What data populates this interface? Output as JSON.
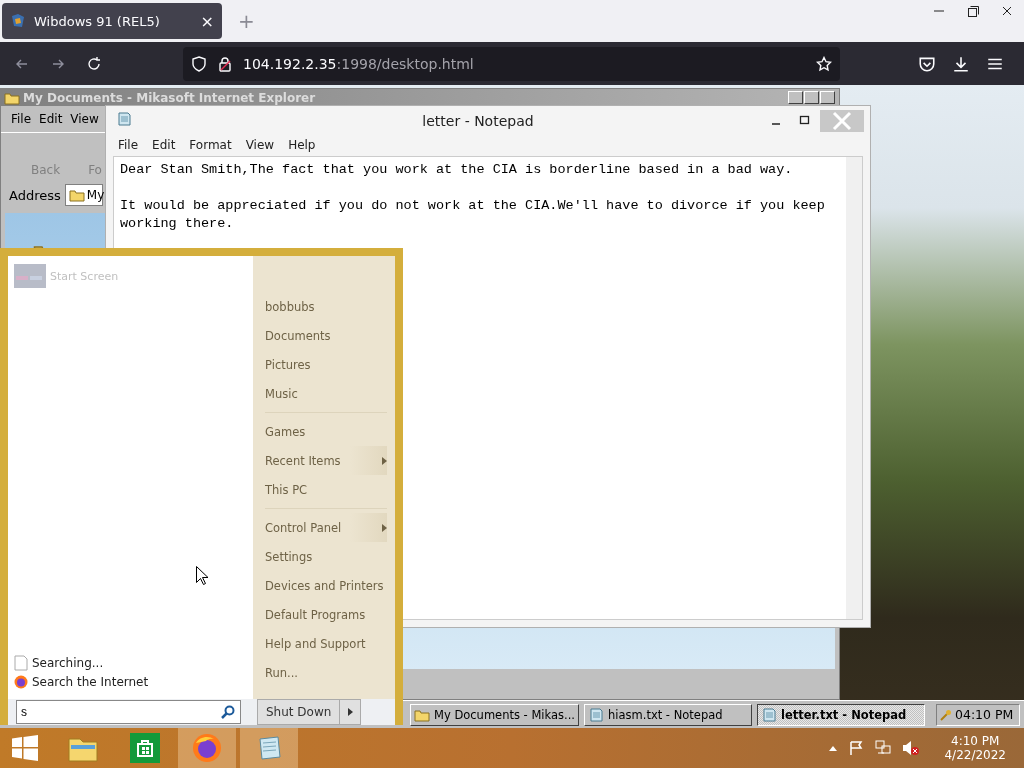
{
  "browser": {
    "tab": {
      "title": "Wibdows 91 (REL5)",
      "close": "×"
    },
    "new_tab": "+",
    "address": {
      "host": "104.192.2.35",
      "rest": ":1998/desktop.html"
    }
  },
  "ie_window": {
    "title": "My Documents - Mikasoft Internet Explorer",
    "menu": [
      "File",
      "Edit",
      "View"
    ],
    "toolbar": [
      "Back",
      "Fo"
    ],
    "address_label": "Address",
    "address_value": "My"
  },
  "notepad": {
    "title": "letter - Notepad",
    "menu": [
      "File",
      "Edit",
      "Format",
      "View",
      "Help"
    ],
    "paragraphs": [
      "Dear Stan Smith,The fact that you work at the CIA is borderline based in a bad way.",
      "It would be appreciated if you do not work at the CIA.We'll have to divorce if you keep working there."
    ]
  },
  "start_menu": {
    "pinned": [
      {
        "label": "Start Screen"
      }
    ],
    "results": [
      {
        "kind": "file",
        "label": "Searching..."
      },
      {
        "kind": "web",
        "label": "Search the Internet"
      }
    ],
    "search": {
      "value": "s"
    },
    "places": [
      [
        {
          "label": "bobbubs",
          "submenu": false
        },
        {
          "label": "Documents",
          "submenu": false
        },
        {
          "label": "Pictures",
          "submenu": false
        },
        {
          "label": "Music",
          "submenu": false
        }
      ],
      [
        {
          "label": "Games",
          "submenu": false
        },
        {
          "label": "Recent Items",
          "submenu": true
        },
        {
          "label": "This PC",
          "submenu": false
        }
      ],
      [
        {
          "label": "Control Panel",
          "submenu": true
        },
        {
          "label": "Settings",
          "submenu": false
        },
        {
          "label": "Devices and Printers",
          "submenu": false
        },
        {
          "label": "Default Programs",
          "submenu": false
        },
        {
          "label": "Help and Support",
          "submenu": false
        },
        {
          "label": "Run...",
          "submenu": false
        }
      ]
    ],
    "shutdown": "Shut Down"
  },
  "old_taskbar": {
    "items": [
      {
        "kind": "folder",
        "label": "My Documents - Mikas...",
        "selected": false
      },
      {
        "kind": "notepad",
        "label": "hiasm.txt - Notepad",
        "selected": false
      },
      {
        "kind": "notepad",
        "label": "letter.txt - Notepad",
        "selected": true
      }
    ],
    "clock": "04:10 PM"
  },
  "taskbar": {
    "apps": [
      {
        "kind": "explorer",
        "running": false
      },
      {
        "kind": "store",
        "running": false
      },
      {
        "kind": "firefox",
        "running": true
      },
      {
        "kind": "notepad",
        "running": true
      }
    ],
    "time": "4:10 PM",
    "date": "4/22/2022"
  }
}
